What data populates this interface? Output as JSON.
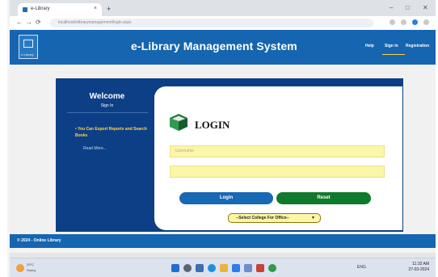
{
  "browser": {
    "tab_title": "e-Library",
    "tab_close": "×",
    "new_tab": "+",
    "url": "localhost/elibrarymanagement/login.aspx",
    "window_controls": [
      "–",
      "□",
      "✕"
    ],
    "nav_back": "←",
    "nav_forward": "→",
    "nav_reload": "⟳"
  },
  "site": {
    "logo_text": "e-Library",
    "title": "e-Library Management System",
    "nav": [
      "Help",
      "Sign In",
      "Registration"
    ]
  },
  "sidebar": {
    "welcome": "Welcome",
    "signin": "Sign In",
    "bullet": "You Can Export Reports and Search Books",
    "read_more": "Read More..."
  },
  "login": {
    "title": "LOGIN",
    "username_placeholder": "Username",
    "password_placeholder": "",
    "login_button": "Login",
    "reset_button": "Reset",
    "college_select": "--Select College For Office--"
  },
  "footer": {
    "text": "© 2024 - Online Library"
  },
  "taskbar": {
    "weather": "29°C",
    "weather_sub": "Sunny",
    "tray": "ENG",
    "time": "11:32 AM",
    "date": "27-03-2024"
  },
  "colors": {
    "header_blue": "#1565b0",
    "panel_navy": "#0d3f86",
    "input_yellow": "#fbf6a8",
    "login_blue": "#1768b5",
    "reset_green": "#0f7a2c",
    "bullet_yellow": "#ffd84d"
  }
}
